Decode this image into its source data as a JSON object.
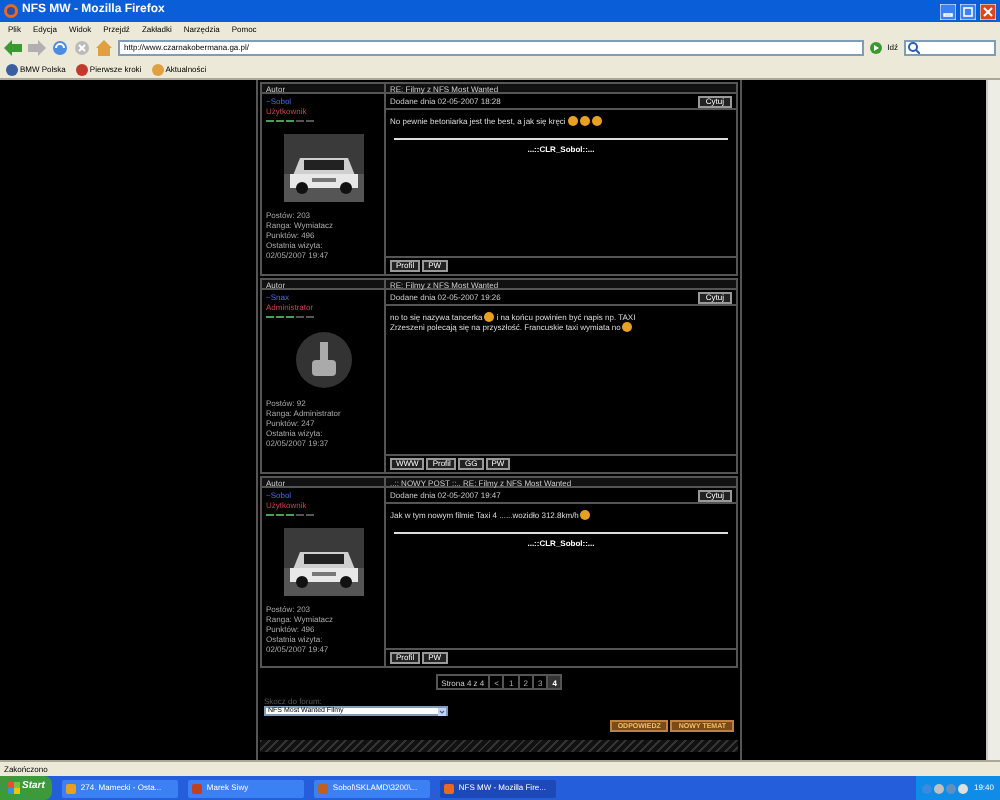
{
  "window": {
    "title": "NFS MW - Mozilla Firefox"
  },
  "menu": [
    "Plik",
    "Edycja",
    "Widok",
    "Przejdź",
    "Zakładki",
    "Narzędzia",
    "Pomoc"
  ],
  "toolbar": {
    "url": "http://www.czarnakobermana.ga.pl/",
    "go": "Idź"
  },
  "bookmarks": [
    "BMW Polska",
    "Pierwsze kroki",
    "Aktualności"
  ],
  "thread": [
    {
      "kind": "header",
      "author_label": "Autor",
      "subject": "RE: Filmy z NFS Most Wanted"
    },
    {
      "kind": "post",
      "author": "~Sobol",
      "role": "Użytkownik",
      "avatar": {
        "kind": "picture"
      },
      "stats": [
        "Postów: 203",
        "Ranga: Wymiatacz",
        "Punktów: 496",
        "Ostatnia wizyta:",
        "02/05/2007 19:47"
      ],
      "date": "Dodane dnia 02-05-2007 18:28",
      "quote": "Cytuj",
      "message": [
        [
          {
            "kind": "text",
            "text": "No pewnie betoniarka jest the best, a jak się kręci"
          },
          {
            "kind": "emoticon"
          },
          {
            "kind": "emoticon"
          },
          {
            "kind": "emoticon"
          }
        ]
      ],
      "signature": "...::CLR_Sobol::...",
      "buttons": [
        "Profil",
        "PW"
      ]
    },
    {
      "kind": "header",
      "author_label": "Autor",
      "subject": "RE: Filmy z NFS Most Wanted"
    },
    {
      "kind": "post",
      "author": "~Snax",
      "role": "Administrator",
      "avatar": {
        "kind": "icon"
      },
      "stats": [
        "Postów: 92",
        "Ranga: Administrator",
        "Punktów: 247",
        "Ostatnia wizyta:",
        "02/05/2007 19:37"
      ],
      "date": "Dodane dnia 02-05-2007 19:26",
      "quote": "Cytuj",
      "message": [
        [
          {
            "kind": "text",
            "text": "no to się nazywa tancerka"
          },
          {
            "kind": "emoticon"
          },
          {
            "kind": "text",
            "text": "i na końcu powinien być napis np. TAXI"
          }
        ],
        [
          {
            "kind": "text",
            "text": "Zrzeszeni polecają się na przyszłość. Francuskie taxi wymiata no"
          },
          {
            "kind": "emoticon"
          }
        ]
      ],
      "buttons": [
        "WWW",
        "Profil",
        "GG",
        "PW"
      ]
    },
    {
      "kind": "header",
      "author_label": "Autor",
      "subject": "..:: NOWY POST ::.. RE: Filmy z NFS Most Wanted"
    },
    {
      "kind": "post",
      "author": "~Sobol",
      "role": "Użytkownik",
      "avatar": {
        "kind": "picture"
      },
      "stats": [
        "Postów: 203",
        "Ranga: Wymiatacz",
        "Punktów: 496",
        "Ostatnia wizyta:",
        "02/05/2007 19:47"
      ],
      "date": "Dodane dnia 02-05-2007 19:47",
      "quote": "Cytuj",
      "message": [
        [
          {
            "kind": "text",
            "text": "Jak w tym nowym filmie Taxi 4 ......wozidło 312.8km/h"
          },
          {
            "kind": "emoticon"
          }
        ]
      ],
      "signature": "...::CLR_Sobol::...",
      "buttons": [
        "Profil",
        "PW"
      ]
    }
  ],
  "pagination": {
    "label": "Strona 4 z 4",
    "pages": [
      {
        "label": "<",
        "selected": false
      },
      {
        "label": "1",
        "selected": false
      },
      {
        "label": "2",
        "selected": false
      },
      {
        "label": "3",
        "selected": false
      },
      {
        "label": "4",
        "selected": true
      }
    ]
  },
  "jump": {
    "label": "Skocz do forum:",
    "value": "NFS Most Wanted Filmy"
  },
  "actions": [
    "ODPOWIEDZ",
    "NOWY TEMAT"
  ],
  "status_bar": "Zakończono",
  "taskbar": {
    "start": "Start",
    "tasks": [
      {
        "label": "274. Mamecki - Osta...",
        "selected": false
      },
      {
        "label": "Marek Siwy",
        "selected": false
      },
      {
        "label": "Sobol\\SKLAMD\\3200\\...",
        "selected": false
      },
      {
        "label": "NFS MW - Mozilla Fire...",
        "selected": true
      }
    ],
    "clock": "19:40"
  }
}
